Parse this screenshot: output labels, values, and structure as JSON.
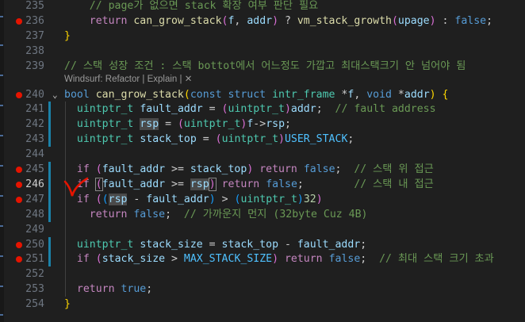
{
  "editor": {
    "codelens": {
      "windsurf": "Windsurf: Refactor | Explain | ",
      "close": "✕"
    },
    "lines": [
      {
        "n": "235",
        "bp": false,
        "segs": [
          {
            "t": "    ",
            "c": "pn"
          },
          {
            "t": "// page가 없으면 stack 확장 여부 판단 필요",
            "c": "co"
          }
        ]
      },
      {
        "n": "236",
        "bp": true,
        "segs": [
          {
            "t": "    ",
            "c": "pn"
          },
          {
            "t": "return",
            "c": "k1"
          },
          {
            "t": " ",
            "c": "pn"
          },
          {
            "t": "can_grow_stack",
            "c": "fn"
          },
          {
            "t": "(",
            "c": "br2"
          },
          {
            "t": "f",
            "c": "vr"
          },
          {
            "t": ", ",
            "c": "pn"
          },
          {
            "t": "addr",
            "c": "vr"
          },
          {
            "t": ")",
            "c": "br2"
          },
          {
            "t": " ? ",
            "c": "pn"
          },
          {
            "t": "vm_stack_growth",
            "c": "fn"
          },
          {
            "t": "(",
            "c": "br2"
          },
          {
            "t": "upage",
            "c": "vr"
          },
          {
            "t": ")",
            "c": "br2"
          },
          {
            "t": " : ",
            "c": "pn"
          },
          {
            "t": "false",
            "c": "kw"
          },
          {
            "t": ";",
            "c": "pn"
          }
        ]
      },
      {
        "n": "237",
        "bp": false,
        "segs": [
          {
            "t": "}",
            "c": "br"
          }
        ]
      },
      {
        "n": "238",
        "bp": false,
        "segs": []
      },
      {
        "n": "239",
        "bp": false,
        "segs": [
          {
            "t": "// 스택 성장 조건 : 스택 bottot에서 어느정도 가깝고 최대스택크기 안 넘어야 됨",
            "c": "co"
          }
        ]
      },
      {
        "n": "240",
        "bp": true,
        "fold": true,
        "segs": [
          {
            "t": "bool",
            "c": "kw"
          },
          {
            "t": " ",
            "c": "pn"
          },
          {
            "t": "can_grow_stack",
            "c": "fn"
          },
          {
            "t": "(",
            "c": "br"
          },
          {
            "t": "const",
            "c": "kw"
          },
          {
            "t": " ",
            "c": "pn"
          },
          {
            "t": "struct",
            "c": "kw"
          },
          {
            "t": " ",
            "c": "pn"
          },
          {
            "t": "intr_frame",
            "c": "ty"
          },
          {
            "t": " *",
            "c": "pn"
          },
          {
            "t": "f",
            "c": "vr"
          },
          {
            "t": ", ",
            "c": "pn"
          },
          {
            "t": "void",
            "c": "kw"
          },
          {
            "t": " *",
            "c": "pn"
          },
          {
            "t": "addr",
            "c": "vr"
          },
          {
            "t": ")",
            "c": "br"
          },
          {
            "t": " ",
            "c": "pn"
          },
          {
            "t": "{",
            "c": "br"
          }
        ]
      },
      {
        "n": "241",
        "bp": false,
        "segs": [
          {
            "t": "  ",
            "c": "pn"
          },
          {
            "t": "uintptr_t",
            "c": "ty"
          },
          {
            "t": " ",
            "c": "pn"
          },
          {
            "t": "fault_addr",
            "c": "vr"
          },
          {
            "t": " = ",
            "c": "pn"
          },
          {
            "t": "(",
            "c": "br2"
          },
          {
            "t": "uintptr_t",
            "c": "ty"
          },
          {
            "t": ")",
            "c": "br2"
          },
          {
            "t": "addr",
            "c": "vr"
          },
          {
            "t": ";  ",
            "c": "pn"
          },
          {
            "t": "// fault address",
            "c": "co"
          }
        ]
      },
      {
        "n": "242",
        "bp": false,
        "segs": [
          {
            "t": "  ",
            "c": "pn"
          },
          {
            "t": "uintptr_t",
            "c": "ty"
          },
          {
            "t": " ",
            "c": "pn"
          },
          {
            "t": "rsp",
            "c": "vr hl"
          },
          {
            "t": " = ",
            "c": "pn"
          },
          {
            "t": "(",
            "c": "br2"
          },
          {
            "t": "uintptr_t",
            "c": "ty"
          },
          {
            "t": ")",
            "c": "br2"
          },
          {
            "t": "f",
            "c": "vr"
          },
          {
            "t": "->",
            "c": "pn"
          },
          {
            "t": "rsp",
            "c": "vr"
          },
          {
            "t": ";",
            "c": "pn"
          }
        ]
      },
      {
        "n": "243",
        "bp": false,
        "segs": [
          {
            "t": "  ",
            "c": "pn"
          },
          {
            "t": "uintptr_t",
            "c": "ty"
          },
          {
            "t": " ",
            "c": "pn"
          },
          {
            "t": "stack_top",
            "c": "vr"
          },
          {
            "t": " = ",
            "c": "pn"
          },
          {
            "t": "(",
            "c": "br2"
          },
          {
            "t": "uintptr_t",
            "c": "ty"
          },
          {
            "t": ")",
            "c": "br2"
          },
          {
            "t": "USER_STACK",
            "c": "cn"
          },
          {
            "t": ";",
            "c": "pn"
          }
        ]
      },
      {
        "n": "244",
        "bp": false,
        "segs": []
      },
      {
        "n": "245",
        "bp": true,
        "segs": [
          {
            "t": "  ",
            "c": "pn"
          },
          {
            "t": "if",
            "c": "k1"
          },
          {
            "t": " ",
            "c": "pn"
          },
          {
            "t": "(",
            "c": "br2"
          },
          {
            "t": "fault_addr",
            "c": "vr"
          },
          {
            "t": " >= ",
            "c": "pn"
          },
          {
            "t": "stack_top",
            "c": "vr"
          },
          {
            "t": ")",
            "c": "br2"
          },
          {
            "t": " ",
            "c": "pn"
          },
          {
            "t": "return",
            "c": "k1"
          },
          {
            "t": " ",
            "c": "pn"
          },
          {
            "t": "false",
            "c": "kw"
          },
          {
            "t": ";  ",
            "c": "pn"
          },
          {
            "t": "// 스택 위 접근",
            "c": "co"
          }
        ]
      },
      {
        "n": "246",
        "bp": true,
        "cur": true,
        "segs": [
          {
            "t": "  ",
            "c": "pn"
          },
          {
            "t": "if",
            "c": "k1"
          },
          {
            "t": " ",
            "c": "pn"
          },
          {
            "t": "(",
            "c": "br2 cursorbox"
          },
          {
            "t": "fault_addr",
            "c": "vr"
          },
          {
            "t": " >= ",
            "c": "pn"
          },
          {
            "t": "rsp",
            "c": "vr hl"
          },
          {
            "t": ")",
            "c": "br2 cursorbox"
          },
          {
            "t": " ",
            "c": "pn"
          },
          {
            "t": "return",
            "c": "k1"
          },
          {
            "t": " ",
            "c": "pn"
          },
          {
            "t": "false",
            "c": "kw"
          },
          {
            "t": ";        ",
            "c": "pn"
          },
          {
            "t": "// 스택 내 접근",
            "c": "co"
          }
        ]
      },
      {
        "n": "247",
        "bp": true,
        "segs": [
          {
            "t": "  ",
            "c": "pn"
          },
          {
            "t": "if",
            "c": "k1"
          },
          {
            "t": " ",
            "c": "pn"
          },
          {
            "t": "(",
            "c": "br2"
          },
          {
            "t": "(",
            "c": "br3"
          },
          {
            "t": "rsp",
            "c": "vr hl"
          },
          {
            "t": " - ",
            "c": "pn"
          },
          {
            "t": "fault_addr",
            "c": "vr"
          },
          {
            "t": ")",
            "c": "br3"
          },
          {
            "t": " > ",
            "c": "pn"
          },
          {
            "t": "(",
            "c": "br3"
          },
          {
            "t": "uintptr_t",
            "c": "ty"
          },
          {
            "t": ")",
            "c": "br3"
          },
          {
            "t": "32",
            "c": "nm"
          },
          {
            "t": ")",
            "c": "br2"
          }
        ]
      },
      {
        "n": "248",
        "bp": false,
        "segs": [
          {
            "t": "    ",
            "c": "pn"
          },
          {
            "t": "return",
            "c": "k1"
          },
          {
            "t": " ",
            "c": "pn"
          },
          {
            "t": "false",
            "c": "kw"
          },
          {
            "t": ";  ",
            "c": "pn"
          },
          {
            "t": "// 가까운지 먼지 (32byte Cuz 4B)",
            "c": "co"
          }
        ]
      },
      {
        "n": "249",
        "bp": false,
        "segs": []
      },
      {
        "n": "250",
        "bp": true,
        "segs": [
          {
            "t": "  ",
            "c": "pn"
          },
          {
            "t": "uintptr_t",
            "c": "ty"
          },
          {
            "t": " ",
            "c": "pn"
          },
          {
            "t": "stack_size",
            "c": "vr"
          },
          {
            "t": " = ",
            "c": "pn"
          },
          {
            "t": "stack_top",
            "c": "vr"
          },
          {
            "t": " - ",
            "c": "pn"
          },
          {
            "t": "fault_addr",
            "c": "vr"
          },
          {
            "t": ";",
            "c": "pn"
          }
        ]
      },
      {
        "n": "251",
        "bp": true,
        "segs": [
          {
            "t": "  ",
            "c": "pn"
          },
          {
            "t": "if",
            "c": "k1"
          },
          {
            "t": " ",
            "c": "pn"
          },
          {
            "t": "(",
            "c": "br2"
          },
          {
            "t": "stack_size",
            "c": "vr"
          },
          {
            "t": " > ",
            "c": "pn"
          },
          {
            "t": "MAX_STACK_SIZE",
            "c": "cn"
          },
          {
            "t": ")",
            "c": "br2"
          },
          {
            "t": " ",
            "c": "pn"
          },
          {
            "t": "return",
            "c": "k1"
          },
          {
            "t": " ",
            "c": "pn"
          },
          {
            "t": "false",
            "c": "kw"
          },
          {
            "t": ";  ",
            "c": "pn"
          },
          {
            "t": "// 최대 스택 크기 초과",
            "c": "co"
          }
        ]
      },
      {
        "n": "252",
        "bp": false,
        "segs": []
      },
      {
        "n": "253",
        "bp": false,
        "segs": [
          {
            "t": "  ",
            "c": "pn"
          },
          {
            "t": "return",
            "c": "k1"
          },
          {
            "t": " ",
            "c": "pn"
          },
          {
            "t": "true",
            "c": "kw"
          },
          {
            "t": ";",
            "c": "pn"
          }
        ]
      },
      {
        "n": "254",
        "bp": false,
        "segs": [
          {
            "t": "}",
            "c": "br"
          }
        ]
      }
    ]
  }
}
